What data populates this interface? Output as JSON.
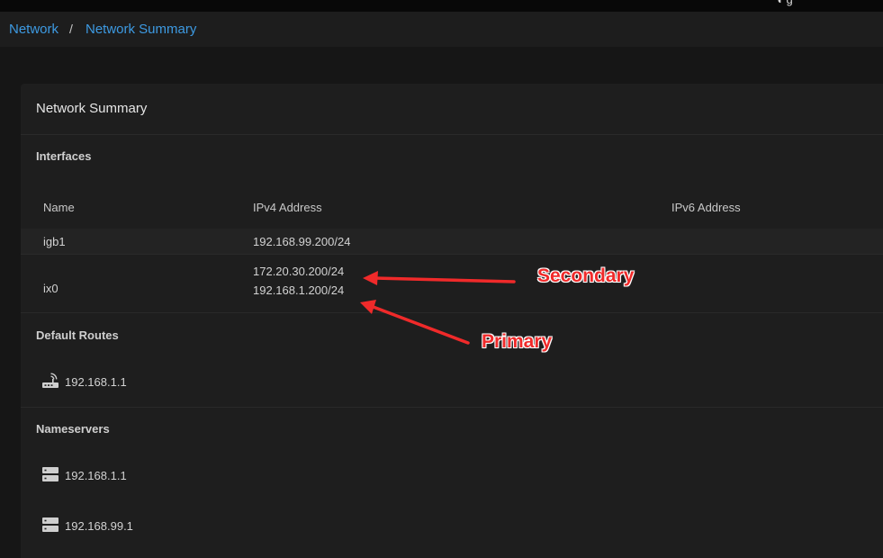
{
  "topbar": {
    "glyph": "◖ g"
  },
  "breadcrumb": {
    "items": [
      "Network",
      "Network Summary"
    ],
    "separator": "/"
  },
  "card": {
    "title": "Network Summary",
    "interfaces": {
      "label": "Interfaces",
      "columns": [
        "Name",
        "IPv4 Address",
        "IPv6 Address"
      ],
      "rows": [
        {
          "name": "igb1",
          "ipv4": [
            "192.168.99.200/24"
          ],
          "ipv6": ""
        },
        {
          "name": "ix0",
          "ipv4": [
            "172.20.30.200/24",
            "192.168.1.200/24"
          ],
          "ipv6": ""
        }
      ]
    },
    "default_routes": {
      "label": "Default Routes",
      "items": [
        {
          "icon": "router-icon",
          "value": "192.168.1.1"
        }
      ]
    },
    "nameservers": {
      "label": "Nameservers",
      "items": [
        {
          "icon": "server-icon",
          "value": "192.168.1.1"
        },
        {
          "icon": "server-icon",
          "value": "192.168.99.1"
        }
      ]
    }
  },
  "annotations": {
    "secondary_label": "Secondary",
    "primary_label": "Primary",
    "color": "#f02a2a"
  },
  "colors": {
    "link": "#3d9ae2",
    "background": "#161616",
    "card": "#1e1e1e"
  }
}
